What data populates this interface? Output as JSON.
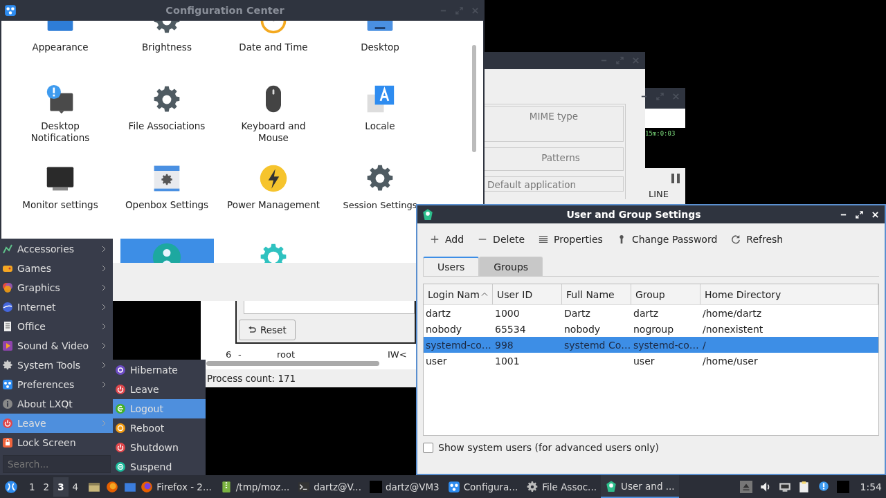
{
  "config_center": {
    "title": "Configuration Center",
    "items": [
      {
        "label": "Appearance",
        "kind": "panel",
        "selected": false
      },
      {
        "label": "Brightness",
        "kind": "gear",
        "selected": false
      },
      {
        "label": "Date and Time",
        "kind": "clock",
        "selected": false
      },
      {
        "label": "Desktop",
        "kind": "screen",
        "selected": false
      },
      {
        "label": "Desktop Notifications",
        "kind": "notice",
        "selected": false
      },
      {
        "label": "File Associations",
        "kind": "gear",
        "selected": false
      },
      {
        "label": "Keyboard and Mouse",
        "kind": "mouse",
        "selected": false
      },
      {
        "label": "Locale",
        "kind": "locale",
        "selected": false
      },
      {
        "label": "Monitor settings",
        "kind": "monitor",
        "selected": false
      },
      {
        "label": "Openbox Settings",
        "kind": "window",
        "selected": false
      },
      {
        "label": "Power Management",
        "kind": "power",
        "selected": false
      },
      {
        "label": "Session Settings",
        "kind": "gear",
        "selected": false
      },
      {
        "kind": "person",
        "selected": true
      },
      {
        "kind": "cog",
        "selected": false
      }
    ]
  },
  "process_window": {
    "row": [
      "6",
      "-",
      "root",
      "IW<"
    ],
    "reset_button": "Reset",
    "status": "Process count: 171"
  },
  "file_associations": {
    "fields": [
      "MIME type",
      "Patterns",
      "Default application"
    ]
  },
  "terminal": {
    "clock": "15m:0:03",
    "label": "LINE"
  },
  "user_settings": {
    "title": "User and Group Settings",
    "toolbar": [
      {
        "label": "Add",
        "kind": "add"
      },
      {
        "label": "Delete",
        "kind": "delete"
      },
      {
        "label": "Properties",
        "kind": "list"
      },
      {
        "label": "Change Password",
        "kind": "key"
      },
      {
        "label": "Refresh",
        "kind": "refresh"
      }
    ],
    "tabs": [
      {
        "label": "Users",
        "selected": true
      },
      {
        "label": "Groups",
        "selected": false
      }
    ],
    "columns": [
      {
        "label": "Login Nam",
        "sorted": true
      },
      {
        "label": "User ID",
        "sorted": false
      },
      {
        "label": "Full Name",
        "sorted": false
      },
      {
        "label": "Group",
        "sorted": false
      },
      {
        "label": "Home Directory",
        "sorted": false
      }
    ],
    "rows": [
      {
        "cells": [
          "dartz",
          "1000",
          "Dartz",
          "dartz",
          "/home/dartz"
        ],
        "selected": false
      },
      {
        "cells": [
          "nobody",
          "65534",
          "nobody",
          "nogroup",
          "/nonexistent"
        ],
        "selected": false
      },
      {
        "cells": [
          "systemd-co…",
          "998",
          "systemd Co…",
          "systemd-co…",
          "/"
        ],
        "selected": true
      },
      {
        "cells": [
          "user",
          "1001",
          "",
          "user",
          "/home/user"
        ],
        "selected": false
      }
    ],
    "show_system_users": {
      "label": "Show system users (for advanced users only)",
      "checked": false
    }
  },
  "menu": {
    "items": [
      {
        "label": "Accessories",
        "kind": "accessories",
        "submenu": true,
        "selected": false
      },
      {
        "label": "Games",
        "kind": "games",
        "submenu": true,
        "selected": false
      },
      {
        "label": "Graphics",
        "kind": "graphics",
        "submenu": true,
        "selected": false
      },
      {
        "label": "Internet",
        "kind": "internet",
        "submenu": true,
        "selected": false
      },
      {
        "label": "Office",
        "kind": "office",
        "submenu": true,
        "selected": false
      },
      {
        "label": "Sound & Video",
        "kind": "media",
        "submenu": true,
        "selected": false
      },
      {
        "label": "System Tools",
        "kind": "system",
        "submenu": true,
        "selected": false
      },
      {
        "label": "Preferences",
        "kind": "preferences",
        "submenu": true,
        "selected": false
      },
      {
        "label": "About LXQt",
        "kind": "info",
        "submenu": false,
        "selected": false
      },
      {
        "label": "Leave",
        "kind": "power",
        "submenu": true,
        "selected": true
      },
      {
        "label": "Lock Screen",
        "kind": "lock",
        "submenu": false,
        "selected": false
      }
    ],
    "search": {
      "placeholder": "Search..."
    },
    "submenu": [
      {
        "label": "Hibernate",
        "kind": "hibernate",
        "selected": false
      },
      {
        "label": "Leave",
        "kind": "power",
        "selected": false
      },
      {
        "label": "Logout",
        "kind": "logout",
        "selected": true
      },
      {
        "label": "Reboot",
        "kind": "reboot",
        "selected": false
      },
      {
        "label": "Shutdown",
        "kind": "power",
        "selected": false
      },
      {
        "label": "Suspend",
        "kind": "suspend",
        "selected": false
      }
    ]
  },
  "taskbar": {
    "desktops": [
      {
        "label": "1",
        "selected": false
      },
      {
        "label": "2",
        "selected": false
      },
      {
        "label": "3",
        "selected": true
      },
      {
        "label": "4",
        "selected": false
      }
    ],
    "tasks": [
      {
        "label": "Firefox - 2...",
        "kind": "firefox",
        "selected": false
      },
      {
        "label": "/tmp/moz...",
        "kind": "archive",
        "selected": false
      },
      {
        "label": "dartz@V...",
        "kind": "terminal",
        "selected": false
      },
      {
        "label": "dartz@VM3",
        "kind": "black",
        "selected": false
      },
      {
        "label": "Configura...",
        "kind": "preferences",
        "selected": false
      },
      {
        "label": "File Assoc...",
        "kind": "gear",
        "selected": false
      },
      {
        "label": "User and ...",
        "kind": "users",
        "selected": true
      }
    ],
    "clock": "1:54"
  }
}
